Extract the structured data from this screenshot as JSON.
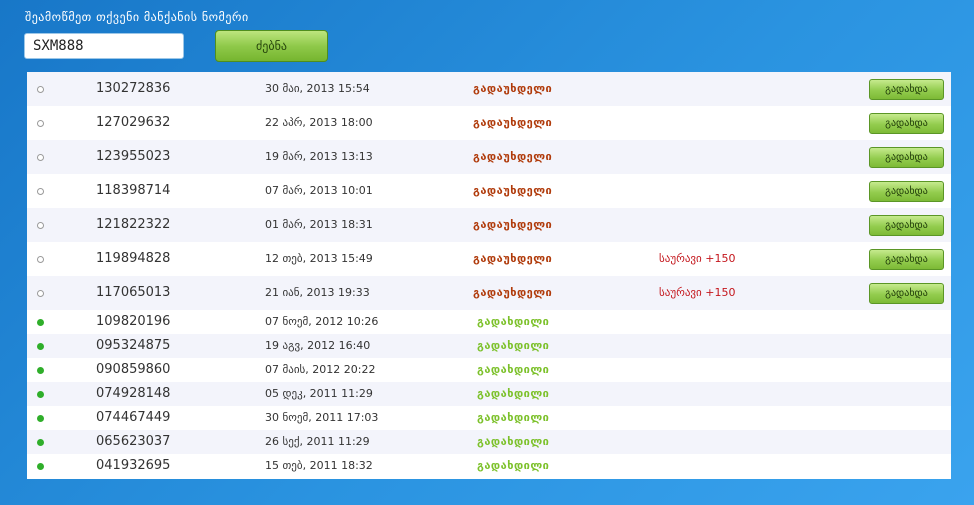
{
  "search": {
    "label": "შეამოწმეთ თქვენი მანქანის ნომერი",
    "value": "SXM888",
    "button_label": "ძებნა"
  },
  "colors": {
    "unpaid": "#b03a0a",
    "paid": "#7cc12a",
    "fee": "#c4161c",
    "background": "#2a93e0"
  },
  "results": [
    {
      "status": "pending",
      "id": "130272836",
      "date": "30 მაი, 2013 15:54",
      "state": "გადაუხდელი",
      "fee": "",
      "action": "გადახდა"
    },
    {
      "status": "pending",
      "id": "127029632",
      "date": "22 აპრ, 2013 18:00",
      "state": "გადაუხდელი",
      "fee": "",
      "action": "გადახდა"
    },
    {
      "status": "pending",
      "id": "123955023",
      "date": "19 მარ, 2013 13:13",
      "state": "გადაუხდელი",
      "fee": "",
      "action": "გადახდა"
    },
    {
      "status": "pending",
      "id": "118398714",
      "date": "07 მარ, 2013 10:01",
      "state": "გადაუხდელი",
      "fee": "",
      "action": "გადახდა"
    },
    {
      "status": "pending",
      "id": "121822322",
      "date": "01 მარ, 2013 18:31",
      "state": "გადაუხდელი",
      "fee": "",
      "action": "გადახდა"
    },
    {
      "status": "pending",
      "id": "119894828",
      "date": "12 თებ, 2013 15:49",
      "state": "გადაუხდელი",
      "fee": "საურავი +150",
      "action": "გადახდა"
    },
    {
      "status": "pending",
      "id": "117065013",
      "date": "21 იან, 2013 19:33",
      "state": "გადაუხდელი",
      "fee": "საურავი +150",
      "action": "გადახდა"
    },
    {
      "status": "done",
      "id": "109820196",
      "date": "07 ნოემ, 2012 10:26",
      "state": "გადახდილი",
      "fee": "",
      "action": ""
    },
    {
      "status": "done",
      "id": "095324875",
      "date": "19 აგვ, 2012 16:40",
      "state": "გადახდილი",
      "fee": "",
      "action": ""
    },
    {
      "status": "done",
      "id": "090859860",
      "date": "07 მაის, 2012 20:22",
      "state": "გადახდილი",
      "fee": "",
      "action": ""
    },
    {
      "status": "done",
      "id": "074928148",
      "date": "05 დეკ, 2011 11:29",
      "state": "გადახდილი",
      "fee": "",
      "action": ""
    },
    {
      "status": "done",
      "id": "074467449",
      "date": "30 ნოემ, 2011 17:03",
      "state": "გადახდილი",
      "fee": "",
      "action": ""
    },
    {
      "status": "done",
      "id": "065623037",
      "date": "26 სექ, 2011 11:29",
      "state": "გადახდილი",
      "fee": "",
      "action": ""
    },
    {
      "status": "done",
      "id": "041932695",
      "date": "15 თებ, 2011 18:32",
      "state": "გადახდილი",
      "fee": "",
      "action": ""
    }
  ]
}
